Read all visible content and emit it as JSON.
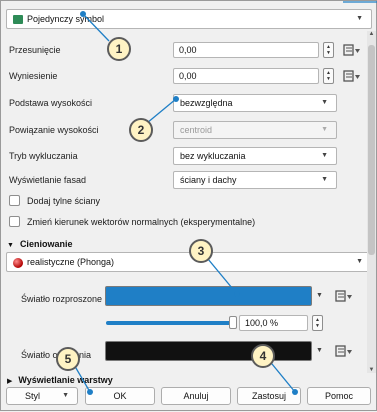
{
  "symbol_type": {
    "label": "Pojedynczy symbol"
  },
  "rows": {
    "offset": {
      "label": "Przesunięcie",
      "value": "0,00"
    },
    "extrusion": {
      "label": "Wyniesienie",
      "value": "0,00"
    },
    "altitude_clamping": {
      "label": "Podstawa wysokości",
      "value": "bezwzględna"
    },
    "altitude_binding": {
      "label": "Powiązanie wysokości",
      "value": "centroid"
    },
    "culling_mode": {
      "label": "Tryb wykluczania",
      "value": "bez wykluczania"
    },
    "facade_rendering": {
      "label": "Wyświetlanie fasad",
      "value": "ściany i dachy"
    }
  },
  "checkboxes": {
    "back_faces": {
      "label": "Dodaj tylne ściany",
      "checked": false
    },
    "invert_normals": {
      "label": "Zmień kierunek wektorów normalnych (eksperymentalne)",
      "checked": false
    }
  },
  "shading": {
    "header": "Cieniowanie",
    "technique": "realistyczne (Phonga)",
    "diffuse_label": "Światło rozproszone",
    "diffuse_color": "#1f7fc6",
    "diffuse_opacity": "100,0 %",
    "diffuse_opacity_value": 1.0,
    "ambient_label": "Światło otoczenia",
    "ambient_color": "#111111"
  },
  "layer_rendering_header": "Wyświetlanie warstwy",
  "buttons": {
    "style": "Styl",
    "ok": "OK",
    "cancel": "Anuluj",
    "apply": "Zastosuj",
    "help": "Pomoc"
  },
  "callouts": [
    "1",
    "2",
    "3",
    "4",
    "5"
  ],
  "colors": {
    "accent": "#1f7fc6",
    "callout_fill": "#fff3c4"
  }
}
